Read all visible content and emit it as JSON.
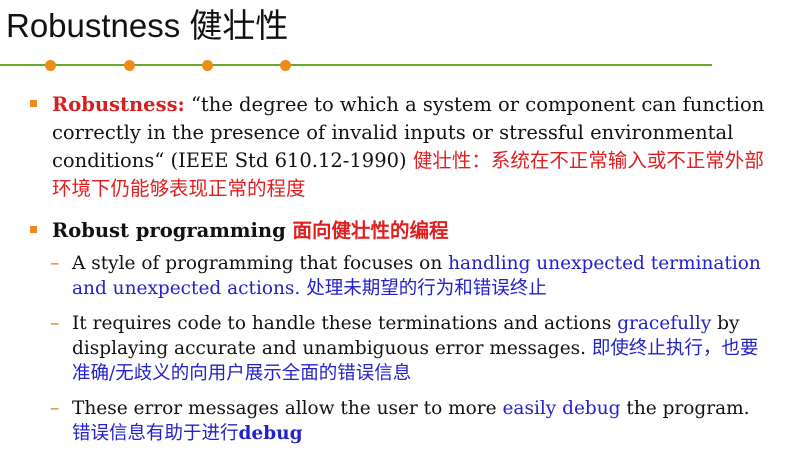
{
  "slide": {
    "title": "Robustness 健壮性"
  },
  "bullets": [
    {
      "term": "Robustness:",
      "definition": " “the degree to which a system or component can function correctly in the presence of invalid inputs or stressful environmental conditions“ (IEEE Std 610.12-1990) ",
      "translation": "健壮性：系统在不正常输入或不正常外部环境下仍能够表现正常的程度"
    },
    {
      "heading": "Robust programming ",
      "heading_cn": "面向健壮性的编程"
    }
  ],
  "sub_bullets": [
    {
      "dash": "–",
      "text_before": "A style of programming that focuses on ",
      "highlight": "handling unexpected termination and unexpected actions.",
      "cn": "  处理未期望的行为和错误终止"
    },
    {
      "dash": "–",
      "text_before": "It requires code to handle these terminations and actions ",
      "highlight": "gracefully",
      "text_after": " by displaying accurate and unambiguous error messages. ",
      "cn": "即使终止执行，也要准确/无歧义的向用户展示全面的错误信息"
    },
    {
      "dash": "–",
      "text_before": "These error messages allow the user to more ",
      "highlight": "easily debug",
      "text_after": " the program. ",
      "cn": "错误信息有助于进行",
      "cn_bold": "debug"
    }
  ],
  "colors": {
    "accent_orange": "#f08a1a",
    "rule_green": "#6aaa2a",
    "term_red": "#d42020",
    "highlight_blue": "#2222cc"
  }
}
